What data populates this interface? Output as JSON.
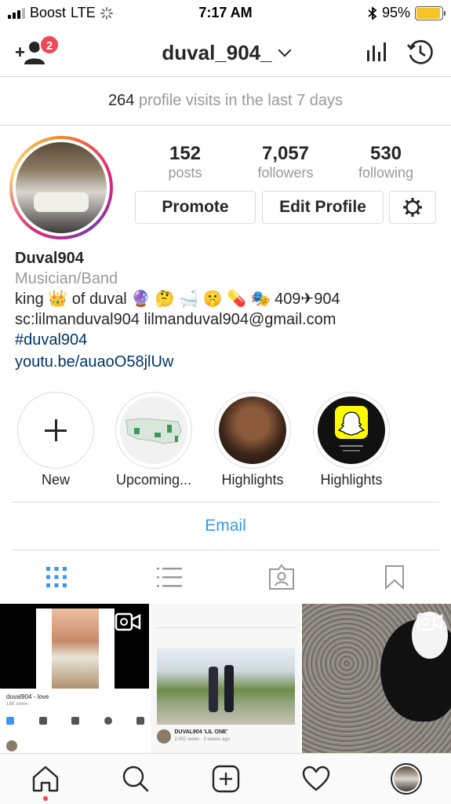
{
  "status_bar": {
    "carrier": "Boost",
    "network": "LTE",
    "time": "7:17 AM",
    "battery_percent": "95%",
    "battery_level": 0.95
  },
  "header": {
    "username": "duval_904_",
    "notification_count": "2"
  },
  "visits": {
    "count": "264",
    "text": "profile visits in the last 7 days"
  },
  "stats": [
    {
      "value": "152",
      "label": "posts"
    },
    {
      "value": "7,057",
      "label": "followers"
    },
    {
      "value": "530",
      "label": "following"
    }
  ],
  "buttons": {
    "promote": "Promote",
    "edit_profile": "Edit Profile"
  },
  "bio": {
    "name": "Duval904",
    "category": "Musician/Band",
    "line1": "king 👑 of duval 🔮 🤔 🛁 🤫 💊 🎭 409✈904",
    "line2": "sc:lilmanduval904 lilmanduval904@gmail.com",
    "hashtag": "#duval904",
    "link": "youtu.be/auaoO58jlUw"
  },
  "highlights": [
    {
      "label": "New"
    },
    {
      "label": "Upcoming..."
    },
    {
      "label": "Highlights"
    },
    {
      "label": "Highlights"
    }
  ],
  "email_button": "Email",
  "posts": [
    {
      "caption": "duval904 - love",
      "views": "18K views"
    },
    {
      "caption": "DUVAL904 'LIL ONE'",
      "views": "2,452 views · 3 weeks ago"
    },
    {
      "caption": ""
    }
  ],
  "colors": {
    "accent_blue": "#3897f0",
    "link_blue": "#003569",
    "badge_red": "#ed4956",
    "battery_yellow": "#f5c528"
  }
}
